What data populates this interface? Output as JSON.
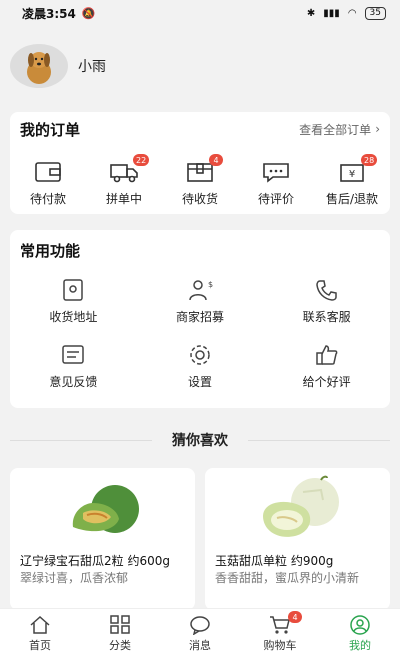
{
  "status_bar": {
    "time": "凌晨3:54",
    "battery": "35"
  },
  "profile": {
    "name": "小雨"
  },
  "orders": {
    "title": "我的订单",
    "view_all": "查看全部订单",
    "items": [
      {
        "label": "待付款",
        "icon": "wallet-icon",
        "badge": ""
      },
      {
        "label": "拼单中",
        "icon": "truck-icon",
        "badge": "22"
      },
      {
        "label": "待收货",
        "icon": "package-icon",
        "badge": "4"
      },
      {
        "label": "待评价",
        "icon": "comment-icon",
        "badge": ""
      },
      {
        "label": "售后/退款",
        "icon": "refund-icon",
        "badge": "28"
      }
    ]
  },
  "functions": {
    "title": "常用功能",
    "items": [
      {
        "label": "收货地址",
        "icon": "address-icon"
      },
      {
        "label": "商家招募",
        "icon": "merchant-icon"
      },
      {
        "label": "联系客服",
        "icon": "phone-icon"
      },
      {
        "label": "意见反馈",
        "icon": "feedback-icon"
      },
      {
        "label": "设置",
        "icon": "gear-icon"
      },
      {
        "label": "给个好评",
        "icon": "thumbs-up-icon"
      }
    ]
  },
  "guess": {
    "title": "猜你喜欢"
  },
  "products": [
    {
      "name": "辽宁绿宝石甜瓜2粒 约600g",
      "desc": "翠绿讨喜，瓜香浓郁"
    },
    {
      "name": "玉菇甜瓜单粒 约900g",
      "desc": "香香甜甜，蜜瓜界的小清新"
    }
  ],
  "tabs": [
    {
      "label": "首页",
      "icon": "home-icon",
      "badge": ""
    },
    {
      "label": "分类",
      "icon": "grid-icon",
      "badge": ""
    },
    {
      "label": "消息",
      "icon": "message-icon",
      "badge": ""
    },
    {
      "label": "购物车",
      "icon": "cart-icon",
      "badge": "4"
    },
    {
      "label": "我的",
      "icon": "user-icon",
      "badge": ""
    }
  ],
  "colors": {
    "accent": "#2aa44f",
    "badge": "#e84c3d"
  }
}
